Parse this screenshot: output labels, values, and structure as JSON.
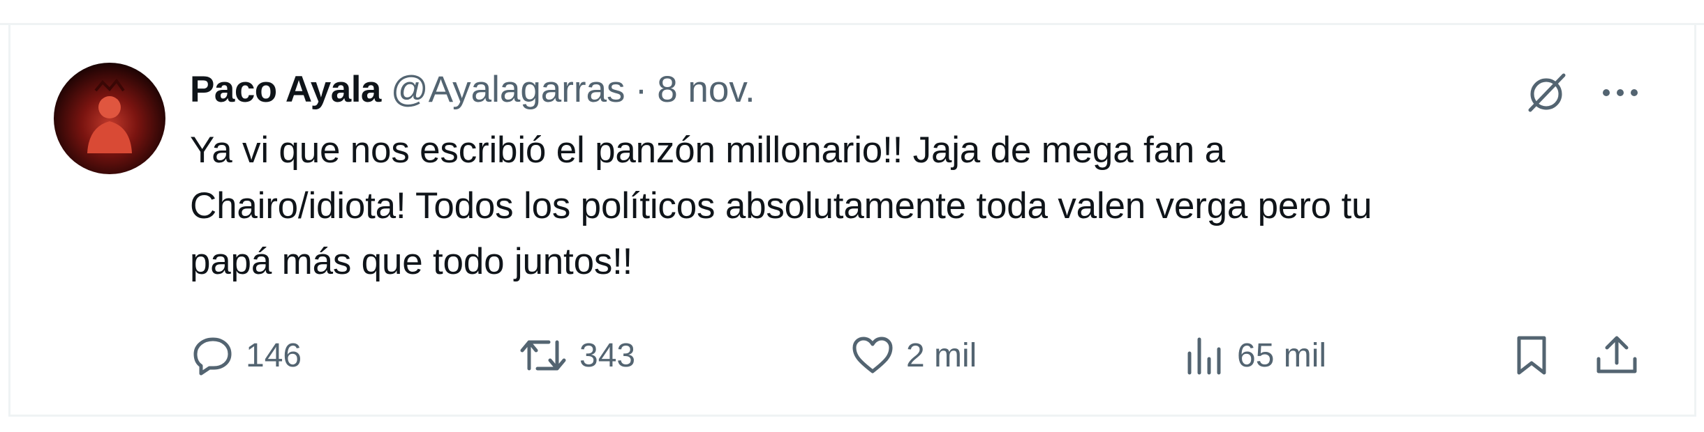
{
  "tweet": {
    "author_name": "Paco Ayala",
    "author_handle": "@Ayalagarras",
    "separator": "·",
    "date": "8 nov.",
    "text_lines": [
      "Ya vi que nos escribió el panzón millonario!! Jaja de mega fan a",
      "Chairo/idiota! Todos los políticos absolutamente toda valen verga pero tu",
      "papá más que todo juntos!!"
    ]
  },
  "actions": {
    "replies": "146",
    "retweets": "343",
    "likes": "2 mil",
    "views": "65 mil"
  },
  "icons": {
    "header": [
      "grok-icon",
      "more-icon"
    ],
    "actions": [
      "reply-icon",
      "retweet-icon",
      "like-icon",
      "views-icon",
      "bookmark-icon",
      "share-icon"
    ]
  },
  "colors": {
    "text_primary": "#0f1419",
    "text_secondary": "#536471",
    "border": "#eff3f4"
  }
}
